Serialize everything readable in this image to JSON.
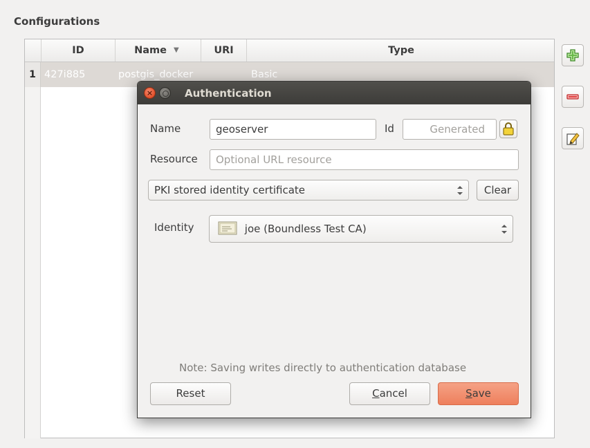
{
  "configurations": {
    "title": "Configurations",
    "columns": [
      "ID",
      "Name",
      "URI",
      "Type"
    ],
    "rows": [
      {
        "num": "1",
        "id": "427i885",
        "name": "postgis_docker",
        "uri": "",
        "type": "Basic"
      }
    ],
    "side_buttons": [
      "add-icon",
      "remove-icon",
      "edit-icon"
    ],
    "sort_indicator": "▼"
  },
  "dialog": {
    "title": "Authentication",
    "name_label": "Name",
    "name_value": "geoserver",
    "id_label": "Id",
    "id_placeholder": "Generated",
    "resource_label": "Resource",
    "resource_placeholder": "Optional URL resource",
    "method_value": "PKI stored identity certificate",
    "clear_label": "Clear",
    "identity_label": "Identity",
    "identity_value": "joe (Boundless Test CA)",
    "note": "Note: Saving writes directly to authentication database",
    "reset_label": "Reset",
    "cancel_label_first": "C",
    "cancel_label_rest": "ancel",
    "save_label_first": "S",
    "save_label_rest": "ave"
  },
  "colors": {
    "accent": "#ee7f5c",
    "titlebar": "#45443f",
    "selected_row": "#ddd9d5"
  }
}
